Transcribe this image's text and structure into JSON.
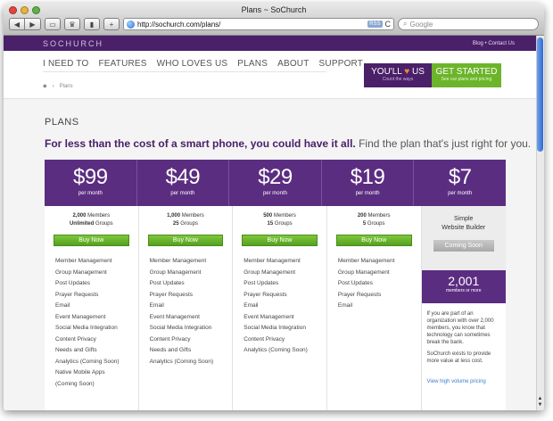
{
  "browser": {
    "title": "Plans ~ SoChurch",
    "url": "http://sochurch.com/plans/",
    "search_placeholder": "Google",
    "rss": "RSS",
    "back": "◀",
    "forward": "▶",
    "reload": "C"
  },
  "site": {
    "logo": "SOCHURCH",
    "toplinks": "Blog  •  Contact Us",
    "nav": [
      "I NEED TO",
      "FEATURES",
      "WHO LOVES US",
      "PLANS",
      "ABOUT",
      "SUPPORT"
    ],
    "breadcrumb": "Plans",
    "cta_you_title": "YOU'LL",
    "cta_you_title2": "US",
    "cta_you_sub": "Count the ways",
    "cta_go_title": "GET STARTED",
    "cta_go_sub": "See our plans and pricing"
  },
  "page": {
    "heading": "PLANS",
    "tagline_strong": "For less than the cost of a smart phone, you could have it all.",
    "tagline_rest": " Find the plan that's just right for you."
  },
  "plans": [
    {
      "price": "$99",
      "period": "per month",
      "members": "2,000",
      "members_label": "Members",
      "groups": "Unlimited",
      "groups_label": "Groups",
      "button": "Buy Now",
      "features": [
        "Member Management",
        "Group Management",
        "Post Updates",
        "Prayer Requests",
        "Email",
        "Event Management",
        "Social Media Integration",
        "Content Privacy",
        "Needs and Gifts",
        "Analytics (Coming Soon)",
        "Native Mobile Apps",
        "(Coming Soon)"
      ]
    },
    {
      "price": "$49",
      "period": "per month",
      "members": "1,000",
      "members_label": "Members",
      "groups": "25",
      "groups_label": "Groups",
      "button": "Buy Now",
      "features": [
        "Member Management",
        "Group Management",
        "Post Updates",
        "Prayer Requests",
        "Email",
        "Event Management",
        "Social Media Integration",
        "Content Privacy",
        "Needs and Gifts",
        "Analytics (Coming Soon)"
      ]
    },
    {
      "price": "$29",
      "period": "per month",
      "members": "500",
      "members_label": "Members",
      "groups": "15",
      "groups_label": "Groups",
      "button": "Buy Now",
      "features": [
        "Member Management",
        "Group Management",
        "Post Updates",
        "Prayer Requests",
        "Email",
        "Event Management",
        "Social Media Integration",
        "Content Privacy",
        "Analytics (Coming Soon)"
      ]
    },
    {
      "price": "$19",
      "period": "per month",
      "members": "200",
      "members_label": "Members",
      "groups": "5",
      "groups_label": "Groups",
      "button": "Buy Now",
      "features": [
        "Member Management",
        "Group Management",
        "Post Updates",
        "Prayer Requests",
        "Email"
      ]
    }
  ],
  "simple_plan": {
    "price": "$7",
    "period": "per month",
    "line1": "Simple",
    "line2": "Website Builder",
    "button": "Coming Soon"
  },
  "volume": {
    "number": "2,001",
    "sub": "members or more",
    "text1": "If you are part of an organization with over 2,000 members, you know that technology can sometimes break the bank.",
    "text2": "SoChurch exists to provide more value at less cost.",
    "link": "View high volume pricing"
  },
  "colors": {
    "brand_purple": "#5b2d80",
    "brand_green": "#6cb52b",
    "link_blue": "#3a7fcc"
  }
}
